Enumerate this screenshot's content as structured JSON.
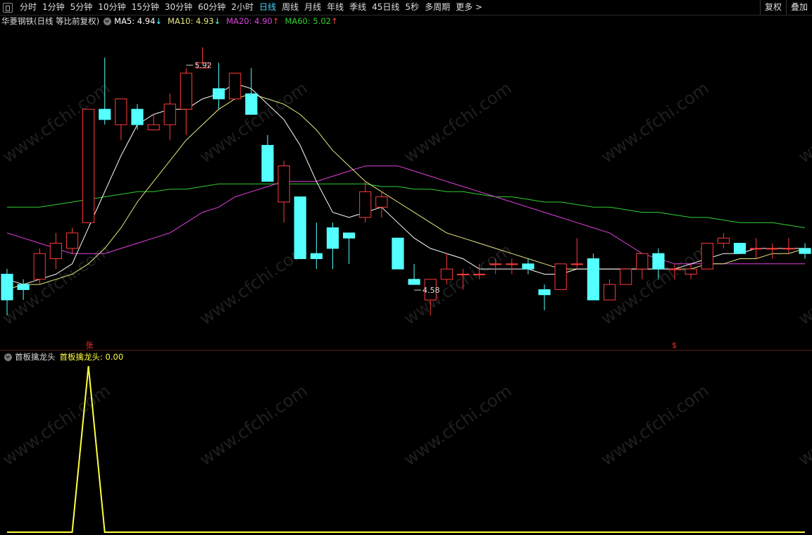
{
  "toolbar": {
    "tabs": [
      "分时",
      "1分钟",
      "5分钟",
      "10分钟",
      "15分钟",
      "30分钟",
      "60分钟",
      "2小时",
      "日线",
      "周线",
      "月线",
      "年线",
      "季线",
      "45日线",
      "5秒",
      "多周期",
      "更多 >"
    ],
    "active_tab": "日线",
    "right_buttons": [
      "复权",
      "叠加"
    ]
  },
  "info": {
    "stock": "华菱钢铁(日线 等比前复权)",
    "ma5": "MA5: 4.94",
    "ma5_arrow": "↓",
    "ma10": "MA10: 4.93",
    "ma10_arrow": "↓",
    "ma20": "MA20: 4.90",
    "ma20_arrow": "↑",
    "ma60": "MA60: 5.02",
    "ma60_arrow": "↑"
  },
  "indicator": {
    "name": "首板擒龙头",
    "label": "首板擒龙头: 0.00"
  },
  "watermark": "www.cfchi.com",
  "colors": {
    "up": "#ff3b3b",
    "down": "#54ffff",
    "ma5": "#ffffff",
    "ma10": "#e8e880",
    "ma20": "#e040e0",
    "ma60": "#30d030",
    "indicator": "#ffff40"
  },
  "chart_data": [
    {
      "type": "candlestick",
      "ylim": [
        4.5,
        5.0
      ],
      "candles": [
        {
          "o": 4.71,
          "h": 4.72,
          "l": 4.63,
          "c": 4.66
        },
        {
          "o": 4.69,
          "h": 4.7,
          "l": 4.66,
          "c": 4.68
        },
        {
          "o": 4.7,
          "h": 4.76,
          "l": 4.69,
          "c": 4.75
        },
        {
          "o": 4.74,
          "h": 4.79,
          "l": 4.72,
          "c": 4.77
        },
        {
          "o": 4.76,
          "h": 4.8,
          "l": 4.75,
          "c": 4.79
        },
        {
          "o": 4.81,
          "h": 5.03,
          "l": 4.81,
          "c": 5.03
        },
        {
          "o": 5.03,
          "h": 5.13,
          "l": 5.0,
          "c": 5.01
        },
        {
          "o": 5.0,
          "h": 5.05,
          "l": 4.97,
          "c": 5.05
        },
        {
          "o": 5.03,
          "h": 5.04,
          "l": 4.99,
          "c": 5.0
        },
        {
          "o": 4.99,
          "h": 5.02,
          "l": 4.99,
          "c": 5.0
        },
        {
          "o": 5.0,
          "h": 5.06,
          "l": 4.97,
          "c": 5.04
        },
        {
          "o": 5.03,
          "h": 5.11,
          "l": 4.98,
          "c": 5.1
        },
        {
          "o": 5.11,
          "h": 5.15,
          "l": 5.11,
          "c": 5.12
        },
        {
          "o": 5.07,
          "h": 5.12,
          "l": 5.03,
          "c": 5.05
        },
        {
          "o": 5.05,
          "h": 5.1,
          "l": 5.05,
          "c": 5.1
        },
        {
          "o": 5.06,
          "h": 5.11,
          "l": 5.02,
          "c": 5.02
        },
        {
          "o": 4.96,
          "h": 4.98,
          "l": 4.89,
          "c": 4.89
        },
        {
          "o": 4.85,
          "h": 4.93,
          "l": 4.81,
          "c": 4.92
        },
        {
          "o": 4.86,
          "h": 4.86,
          "l": 4.74,
          "c": 4.74
        },
        {
          "o": 4.75,
          "h": 4.81,
          "l": 4.72,
          "c": 4.74
        },
        {
          "o": 4.8,
          "h": 4.81,
          "l": 4.72,
          "c": 4.76
        },
        {
          "o": 4.79,
          "h": 4.79,
          "l": 4.73,
          "c": 4.78
        },
        {
          "o": 4.82,
          "h": 4.89,
          "l": 4.81,
          "c": 4.87
        },
        {
          "o": 4.84,
          "h": 4.87,
          "l": 4.82,
          "c": 4.86
        },
        {
          "o": 4.78,
          "h": 4.78,
          "l": 4.72,
          "c": 4.72
        },
        {
          "o": 4.7,
          "h": 4.73,
          "l": 4.69,
          "c": 4.69
        },
        {
          "o": 4.66,
          "h": 4.7,
          "l": 4.63,
          "c": 4.7
        },
        {
          "o": 4.7,
          "h": 4.75,
          "l": 4.69,
          "c": 4.72
        },
        {
          "o": 4.71,
          "h": 4.72,
          "l": 4.68,
          "c": 4.71
        },
        {
          "o": 4.71,
          "h": 4.73,
          "l": 4.7,
          "c": 4.71
        },
        {
          "o": 4.73,
          "h": 4.74,
          "l": 4.71,
          "c": 4.73
        },
        {
          "o": 4.73,
          "h": 4.74,
          "l": 4.71,
          "c": 4.73
        },
        {
          "o": 4.73,
          "h": 4.74,
          "l": 4.71,
          "c": 4.72
        },
        {
          "o": 4.68,
          "h": 4.69,
          "l": 4.64,
          "c": 4.67
        },
        {
          "o": 4.68,
          "h": 4.73,
          "l": 4.68,
          "c": 4.73
        },
        {
          "o": 4.73,
          "h": 4.78,
          "l": 4.72,
          "c": 4.73
        },
        {
          "o": 4.74,
          "h": 4.75,
          "l": 4.66,
          "c": 4.66
        },
        {
          "o": 4.66,
          "h": 4.7,
          "l": 4.66,
          "c": 4.69
        },
        {
          "o": 4.69,
          "h": 4.72,
          "l": 4.69,
          "c": 4.72
        },
        {
          "o": 4.72,
          "h": 4.75,
          "l": 4.7,
          "c": 4.75
        },
        {
          "o": 4.75,
          "h": 4.76,
          "l": 4.7,
          "c": 4.72
        },
        {
          "o": 4.72,
          "h": 4.73,
          "l": 4.7,
          "c": 4.72
        },
        {
          "o": 4.71,
          "h": 4.73,
          "l": 4.7,
          "c": 4.72
        },
        {
          "o": 4.72,
          "h": 4.77,
          "l": 4.72,
          "c": 4.77
        },
        {
          "o": 4.77,
          "h": 4.79,
          "l": 4.76,
          "c": 4.78
        },
        {
          "o": 4.77,
          "h": 4.77,
          "l": 4.75,
          "c": 4.75
        },
        {
          "o": 4.76,
          "h": 4.78,
          "l": 4.74,
          "c": 4.76
        },
        {
          "o": 4.76,
          "h": 4.77,
          "l": 4.74,
          "c": 4.76
        },
        {
          "o": 4.76,
          "h": 4.78,
          "l": 4.75,
          "c": 4.76
        },
        {
          "o": 4.76,
          "h": 4.77,
          "l": 4.74,
          "c": 4.75
        }
      ],
      "ma5": [
        4.7,
        4.69,
        4.7,
        4.71,
        4.73,
        4.8,
        4.87,
        4.94,
        5.0,
        5.02,
        5.03,
        5.03,
        5.05,
        5.06,
        5.08,
        5.07,
        5.04,
        5.01,
        4.96,
        4.89,
        4.83,
        4.82,
        4.83,
        4.84,
        4.81,
        4.78,
        4.76,
        4.75,
        4.74,
        4.72,
        4.72,
        4.72,
        4.72,
        4.71,
        4.71,
        4.72,
        4.72,
        4.72,
        4.72,
        4.72,
        4.72,
        4.72,
        4.73,
        4.74,
        4.75,
        4.75,
        4.76,
        4.76,
        4.76,
        4.76
      ],
      "ma10": [
        4.68,
        4.69,
        4.69,
        4.7,
        4.71,
        4.73,
        4.76,
        4.8,
        4.85,
        4.89,
        4.93,
        4.97,
        5.0,
        5.03,
        5.05,
        5.06,
        5.05,
        5.04,
        5.02,
        4.99,
        4.95,
        4.92,
        4.89,
        4.87,
        4.85,
        4.83,
        4.81,
        4.79,
        4.78,
        4.77,
        4.76,
        4.75,
        4.74,
        4.73,
        4.72,
        4.72,
        4.72,
        4.72,
        4.72,
        4.72,
        4.72,
        4.72,
        4.72,
        4.73,
        4.73,
        4.74,
        4.74,
        4.75,
        4.75,
        4.76
      ],
      "ma20": [
        4.79,
        4.78,
        4.77,
        4.76,
        4.75,
        4.75,
        4.75,
        4.76,
        4.77,
        4.78,
        4.79,
        4.81,
        4.83,
        4.84,
        4.86,
        4.87,
        4.88,
        4.89,
        4.89,
        4.89,
        4.9,
        4.91,
        4.92,
        4.92,
        4.92,
        4.91,
        4.9,
        4.89,
        4.88,
        4.87,
        4.86,
        4.85,
        4.84,
        4.83,
        4.82,
        4.81,
        4.8,
        4.79,
        4.77,
        4.75,
        4.74,
        4.73,
        4.73,
        4.73,
        4.73,
        4.73,
        4.73,
        4.73,
        4.73,
        4.73
      ],
      "ma60": [
        4.84,
        4.84,
        4.84,
        4.845,
        4.85,
        4.855,
        4.86,
        4.865,
        4.87,
        4.87,
        4.875,
        4.875,
        4.88,
        4.885,
        4.885,
        4.885,
        4.885,
        4.885,
        4.885,
        4.885,
        4.885,
        4.885,
        4.885,
        4.88,
        4.88,
        4.875,
        4.875,
        4.87,
        4.87,
        4.865,
        4.86,
        4.86,
        4.855,
        4.85,
        4.85,
        4.845,
        4.84,
        4.84,
        4.835,
        4.83,
        4.83,
        4.825,
        4.82,
        4.82,
        4.815,
        4.81,
        4.81,
        4.81,
        4.805,
        4.8
      ],
      "annotations": [
        {
          "label": "5.92",
          "index": 11
        },
        {
          "label": "4.58",
          "index": 25
        }
      ],
      "markers": [
        {
          "label": "张",
          "index": 5
        },
        {
          "label": "$",
          "index": 41
        }
      ]
    },
    {
      "type": "line",
      "title": "首板擒龙头",
      "values": [
        0,
        0,
        0,
        0,
        0,
        1,
        0,
        0,
        0,
        0,
        0,
        0,
        0,
        0,
        0,
        0,
        0,
        0,
        0,
        0,
        0,
        0,
        0,
        0,
        0,
        0,
        0,
        0,
        0,
        0,
        0,
        0,
        0,
        0,
        0,
        0,
        0,
        0,
        0,
        0,
        0,
        0,
        0,
        0,
        0,
        0,
        0,
        0,
        0,
        0
      ],
      "ylim": [
        0,
        1
      ]
    }
  ]
}
